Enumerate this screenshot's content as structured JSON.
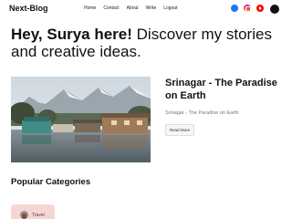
{
  "nav": {
    "logo": "Next-Blog",
    "links": [
      "Home",
      "Contact",
      "About",
      "Write",
      "Logout"
    ]
  },
  "social_icons": [
    "facebook-icon",
    "instagram-icon",
    "youtube-icon"
  ],
  "theme_toggle_icon": "dark-mode-toggle",
  "hero": {
    "greeting": "Hey, Surya here!",
    "tagline": " Discover my stories and creative ideas."
  },
  "featured_post": {
    "title": "Srinagar - The Paradise on Earth",
    "description": "Srinagar - The Paradise on Earth",
    "button_label": "Read More"
  },
  "categories": {
    "heading": "Popular Categories",
    "items": [
      {
        "label": "Travel"
      }
    ]
  },
  "colors": {
    "facebook": "#1877f2",
    "youtube": "#ff0000",
    "category_chip": "#f6d6d2"
  }
}
